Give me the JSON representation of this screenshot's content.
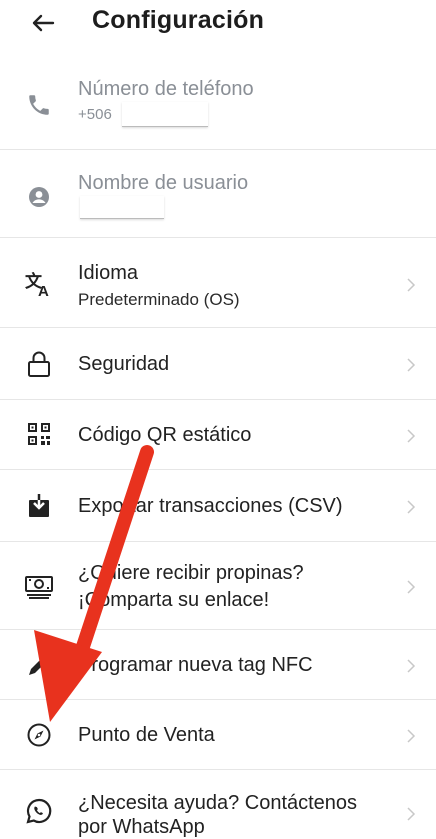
{
  "header": {
    "title": "Configuración",
    "back_icon": "arrow-left-icon"
  },
  "rows": [
    {
      "id": "phone",
      "icon": "phone-icon",
      "label": "Número de teléfono",
      "value": "+506"
    },
    {
      "id": "username",
      "icon": "user-icon",
      "label": "Nombre de usuario",
      "value": ""
    },
    {
      "id": "language",
      "icon": "translate-icon",
      "label": "Idioma",
      "value": "Predeterminado (OS)"
    },
    {
      "id": "security",
      "icon": "lock-icon",
      "label": "Seguridad"
    },
    {
      "id": "qr",
      "icon": "qr-code-icon",
      "label": "Código QR estático"
    },
    {
      "id": "export",
      "icon": "download-icon",
      "label": "Exportar transacciones (CSV)"
    },
    {
      "id": "tips",
      "icon": "money-icon",
      "label": "¿Quiere recibir propinas?",
      "label2": "¡Comparta su enlace!"
    },
    {
      "id": "nfc",
      "icon": "pen-icon",
      "label": "Programar nueva tag NFC"
    },
    {
      "id": "pos",
      "icon": "compass-icon",
      "label": "Punto de Venta"
    },
    {
      "id": "help",
      "icon": "whatsapp-icon",
      "label": "¿Necesita ayuda? Contáctenos",
      "label2": "por WhatsApp"
    }
  ],
  "colors": {
    "muted": "#8a8f96",
    "divider": "#e6e6e6",
    "arrow": "#e8321e"
  }
}
